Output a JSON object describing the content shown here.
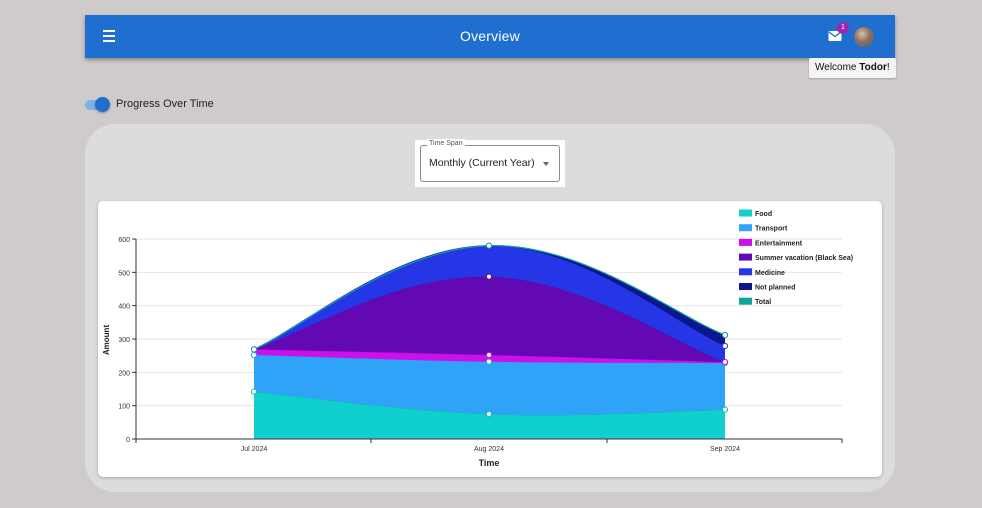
{
  "app": {
    "title": "Overview",
    "mail_badge_count": "1",
    "welcome_prefix": "Welcome ",
    "welcome_user": "Todor",
    "welcome_suffix": "!"
  },
  "toggle": {
    "label": "Progress Over Time",
    "checked": true
  },
  "timespan": {
    "legend": "Time Span",
    "value": "Monthly (Current Year)"
  },
  "colors": {
    "appbar": "#1e6fd0",
    "badge": "#9c27b0"
  },
  "chart_data": {
    "type": "area",
    "stacked": true,
    "x": [
      "Jul 2024",
      "Aug 2024",
      "Sep 2024"
    ],
    "xlabel": "Time",
    "ylabel": "Amount",
    "ylim": [
      0,
      600
    ],
    "yticks": [
      0,
      100,
      200,
      300,
      400,
      500,
      600
    ],
    "grid": true,
    "legend_position": "top-right",
    "series": [
      {
        "name": "Food",
        "color": "#14b8a6",
        "fill": "#10d0cf",
        "values": [
          142,
          75,
          88
        ]
      },
      {
        "name": "Transport",
        "color": "#2f9cf4",
        "fill": "#2fa3f8",
        "values": [
          110,
          157,
          140
        ]
      },
      {
        "name": "Entertainment",
        "color": "#c20ed6",
        "fill": "#cc10ea",
        "values": [
          17,
          20,
          3
        ]
      },
      {
        "name": "Summer vacation (Black Sea)",
        "color": "#5a0ea0",
        "fill": "#6209b3",
        "values": [
          0,
          235,
          0
        ]
      },
      {
        "name": "Medicine",
        "color": "#2438d6",
        "fill": "#2536e6",
        "values": [
          0,
          93,
          48
        ]
      },
      {
        "name": "Not planned",
        "color": "#0c1488",
        "fill": "#0b168f",
        "values": [
          0,
          0,
          33
        ]
      },
      {
        "name": "Total",
        "color": "#12a39a",
        "fill": "none",
        "values": [
          269,
          580,
          312
        ]
      }
    ]
  }
}
